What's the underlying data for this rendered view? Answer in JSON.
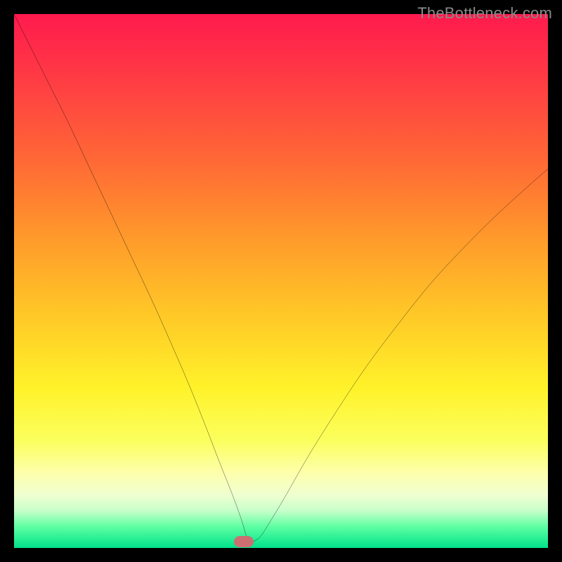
{
  "watermark": "TheBottleneck.com",
  "chart_data": {
    "type": "line",
    "title": "",
    "xlabel": "",
    "ylabel": "",
    "xlim": [
      0,
      100
    ],
    "ylim": [
      0,
      100
    ],
    "x": [
      0,
      3,
      6,
      10,
      14,
      18,
      22,
      26,
      30,
      33,
      36,
      38.5,
      40.5,
      42,
      43,
      43.5,
      44,
      46,
      48,
      51,
      55,
      60,
      66,
      72,
      78,
      84,
      90,
      96,
      100
    ],
    "values": [
      100,
      94,
      88,
      80,
      71.5,
      63,
      54.5,
      46,
      37,
      30,
      22.5,
      16,
      11,
      7,
      4,
      2.2,
      1,
      2,
      5,
      10,
      17,
      25,
      34,
      42,
      49.5,
      56,
      62,
      67.5,
      71
    ],
    "marker": {
      "x": 43,
      "y": 1.2
    },
    "colors": {
      "top": "#ff1a4d",
      "mid": "#ffe833",
      "bottom": "#00e28a",
      "curve": "#000000",
      "marker": "#cc6f73",
      "frame": "#000000"
    },
    "grid": false
  }
}
